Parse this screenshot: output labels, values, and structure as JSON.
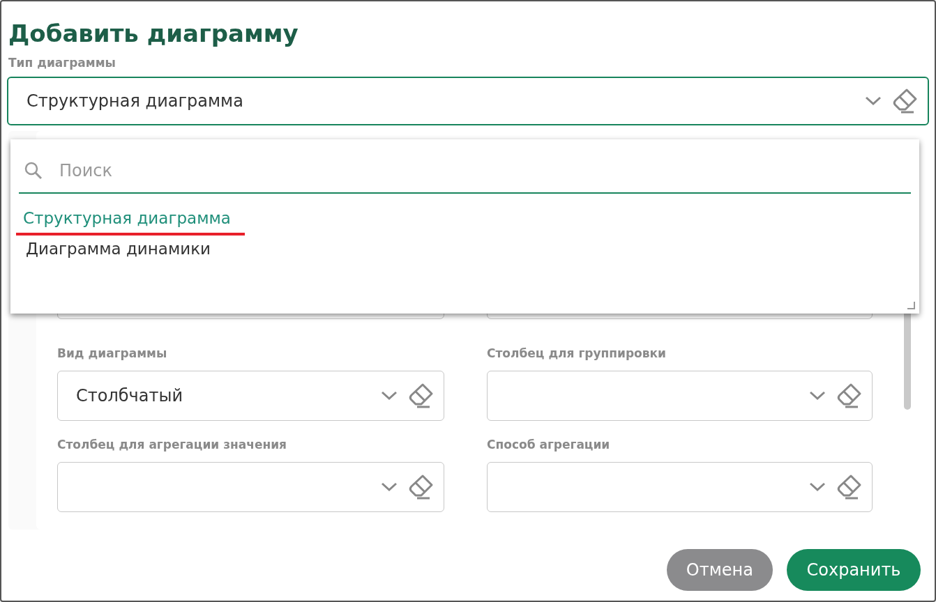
{
  "dialog": {
    "title": "Добавить диаграмму"
  },
  "chart_type": {
    "label": "Тип диаграммы",
    "value": "Структурная диаграмма",
    "focused": true
  },
  "dropdown": {
    "search": {
      "placeholder": "Поиск"
    },
    "options": [
      {
        "label": "Структурная диаграмма",
        "selected": true,
        "annotated": true
      },
      {
        "label": "Диаграмма динамики",
        "selected": false,
        "annotated": false
      }
    ]
  },
  "fields": [
    {
      "kind": "covered"
    },
    {
      "kind": "covered"
    },
    {
      "kind": "select",
      "label": "Вид диаграммы",
      "value": "Столбчатый"
    },
    {
      "kind": "select",
      "label": "Столбец для группировки"
    },
    {
      "kind": "select",
      "label": "Столбец для агрегации значения"
    },
    {
      "kind": "select",
      "label": "Способ агрегации"
    }
  ],
  "buttons": [
    {
      "label": "Отмена",
      "kind": "secondary"
    },
    {
      "label": "Сохранить",
      "kind": "primary"
    }
  ]
}
